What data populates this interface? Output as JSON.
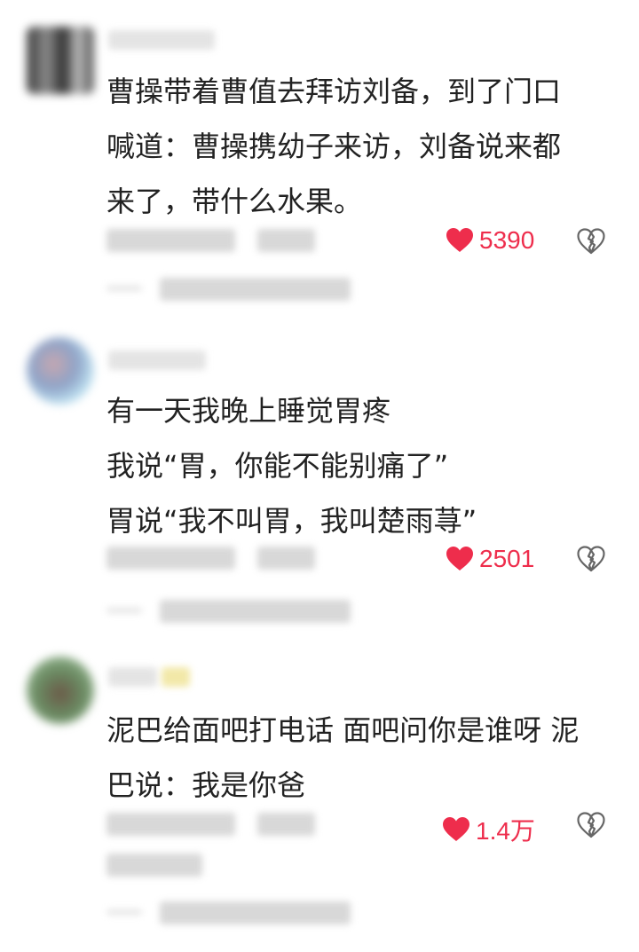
{
  "colors": {
    "like_red": "#ee2d4c",
    "text": "#222222",
    "icon_gray": "#666666"
  },
  "comments": [
    {
      "lines": [
        "曹操带着曹值去拜访刘备，到了门口",
        "喊道：曹操携幼子来访，刘备说来都",
        "来了，带什么水果。"
      ],
      "likes": "5390",
      "like_icon": "heart-icon",
      "dislike_icon": "broken-heart-icon"
    },
    {
      "lines": [
        "有一天我晚上睡觉胃疼",
        "我说“胃，你能不能别痛了”",
        "胃说“我不叫胃，我叫楚雨荨”"
      ],
      "likes": "2501",
      "like_icon": "heart-icon",
      "dislike_icon": "broken-heart-icon"
    },
    {
      "lines": [
        "泥巴给面吧打电话 面吧问你是谁呀 泥",
        "巴说：我是你爸"
      ],
      "likes": "1.4万",
      "like_icon": "heart-icon",
      "dislike_icon": "broken-heart-icon"
    }
  ]
}
